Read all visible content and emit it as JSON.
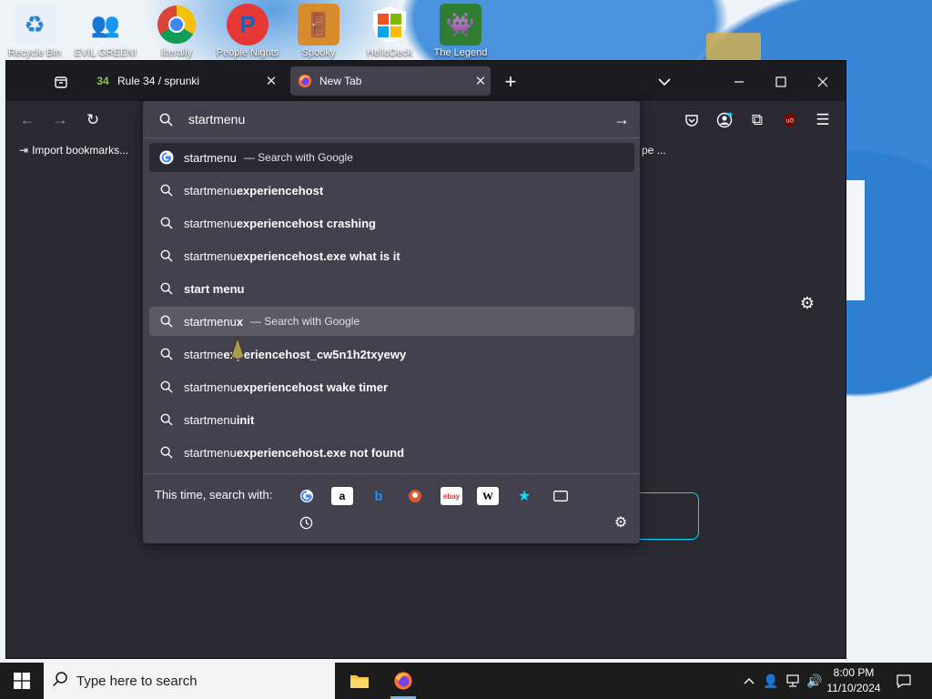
{
  "desktop": {
    "icons": [
      {
        "label": "Recycle Bin",
        "icon": "recycle-bin-icon"
      },
      {
        "label": "EVIL GREEN!",
        "icon": "green-people-icon"
      },
      {
        "label": "literally",
        "icon": "chrome-icon"
      },
      {
        "label": "People Nights",
        "icon": "p-logo-icon"
      },
      {
        "label": "Spooky",
        "icon": "door-icon"
      },
      {
        "label": "HelloDeck",
        "icon": "windows-shield-icon"
      },
      {
        "label": "The Legend",
        "icon": "pixel-character-icon"
      }
    ]
  },
  "browser": {
    "tabs": [
      {
        "title": "Rule 34 / sprunki",
        "active": false,
        "favicon": "site-favicon"
      },
      {
        "title": "New Tab",
        "active": true,
        "favicon": "firefox-icon"
      }
    ],
    "bookmarks": {
      "import_label": "Import bookmarks...",
      "truncated_item": "pe ..."
    },
    "urlbar": {
      "value": "startmenu",
      "results": [
        {
          "prefix": "startmenu",
          "bold": "",
          "action": "Search with Google",
          "icon": "google-icon",
          "state": "selected"
        },
        {
          "prefix": "startmenu",
          "bold": "experiencehost",
          "action": "",
          "icon": "search-icon",
          "state": ""
        },
        {
          "prefix": "startmenu",
          "bold": "experiencehost crashing",
          "action": "",
          "icon": "search-icon",
          "state": ""
        },
        {
          "prefix": "startmenu",
          "bold": "experiencehost.exe what is it",
          "action": "",
          "icon": "search-icon",
          "state": ""
        },
        {
          "prefix": "",
          "bold": "start menu",
          "action": "",
          "icon": "search-icon",
          "state": ""
        },
        {
          "prefix": "startmenu",
          "bold": "x",
          "action": "Search with Google",
          "icon": "search-icon",
          "state": "hover"
        },
        {
          "prefix": "startme",
          "bold": "experiencehost_cw5n1h2txyewy",
          "action": "",
          "icon": "search-icon",
          "state": ""
        },
        {
          "prefix": "startmenu",
          "bold": "experiencehost wake timer",
          "action": "",
          "icon": "search-icon",
          "state": ""
        },
        {
          "prefix": "startmenu",
          "bold": "init",
          "action": "",
          "icon": "search-icon",
          "state": ""
        },
        {
          "prefix": "startmenu",
          "bold": "experiencehost.exe not found",
          "action": "",
          "icon": "search-icon",
          "state": ""
        }
      ],
      "oneoff_label": "This time, search with:",
      "engines": [
        "google",
        "amazon",
        "bing",
        "duckduckgo",
        "ebay",
        "wikipedia",
        "bookmarks",
        "tabs"
      ]
    }
  },
  "taskbar": {
    "search_placeholder": "Type here to search",
    "time": "8:00 PM",
    "date": "11/10/2024"
  },
  "colors": {
    "firefox_dark": "#1c1b22",
    "toolbar": "#2b2a33",
    "popup": "#42414d",
    "accent": "#00ddff"
  }
}
